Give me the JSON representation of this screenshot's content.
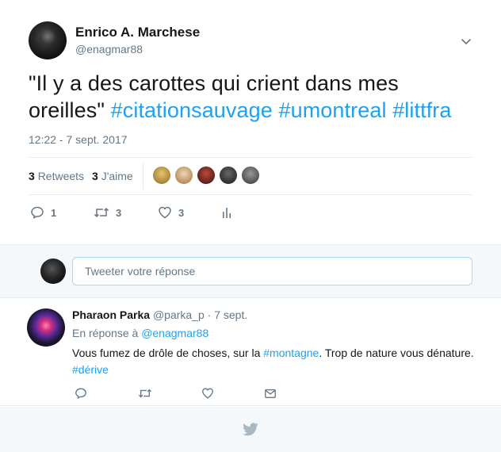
{
  "tweet": {
    "author_name": "Enrico A. Marchese",
    "author_handle": "@enagmar88",
    "text_plain": "\"Il y a des carottes qui crient dans mes oreilles\" ",
    "hashtags": [
      "#citationsauvage",
      "#umontreal",
      "#littfra"
    ],
    "timestamp": "12:22 - 7 sept. 2017",
    "stats": {
      "retweets_count": "3",
      "retweets_label": "Retweets",
      "likes_count": "3",
      "likes_label": "J'aime"
    },
    "actions": {
      "reply_count": "1",
      "retweet_count": "3",
      "like_count": "3"
    },
    "liker_colors": [
      "#c9a04a",
      "#d8b07a",
      "#8a2a2a",
      "#3a3a3a",
      "#5a5a5a"
    ]
  },
  "reply_composer": {
    "placeholder": "Tweeter votre réponse"
  },
  "reply": {
    "author_name": "Pharaon Parka",
    "author_handle": "@parka_p",
    "date": "· 7 sept.",
    "in_reply_prefix": "En réponse à",
    "in_reply_handle": "@enagmar88",
    "text_before": "Vous fumez de drôle de choses, sur la ",
    "hashtag_mid": "#montagne",
    "text_after": ". Trop de nature vous dénature.",
    "hashtag_end": "#dérive"
  },
  "colors": {
    "accent": "#1da1f2",
    "muted": "#657786",
    "text": "#14171a",
    "border": "#e6ecf0",
    "panel_bg": "#f5f8fa"
  },
  "icons": [
    "chevron-down-icon",
    "reply-icon",
    "retweet-icon",
    "like-icon",
    "analytics-icon",
    "message-icon",
    "twitter-bird-icon"
  ]
}
